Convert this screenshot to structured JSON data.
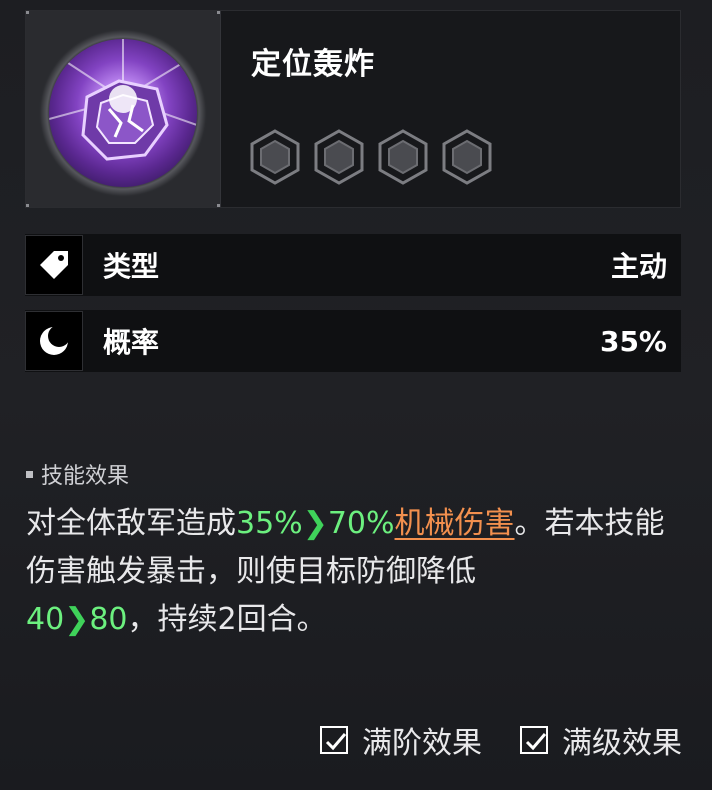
{
  "skill": {
    "name": "定位轰炸",
    "icon": "purple-explosion-skill-icon",
    "star_count": 4
  },
  "attributes": [
    {
      "icon": "tag-icon",
      "label": "类型",
      "value": "主动"
    },
    {
      "icon": "moon-icon",
      "label": "概率",
      "value": "35%"
    }
  ],
  "effect": {
    "section_title": "技能效果",
    "parts": {
      "p1": "对全体敌军造成",
      "v1_from": "35%",
      "v1_to": "70%",
      "damage_type": "机械伤害",
      "p2": "。若本技能伤害触发暴击，则使目标防御降低",
      "v2_from": "40",
      "v2_to": "80",
      "p3": "，持续2回合。"
    }
  },
  "options": {
    "max_stage": {
      "label": "满阶效果",
      "checked": true
    },
    "max_level": {
      "label": "满级效果",
      "checked": true
    }
  },
  "colors": {
    "highlight_green": "#6cf07f",
    "damage_orange": "#f3904e",
    "skill_purple": "#8243c2"
  }
}
